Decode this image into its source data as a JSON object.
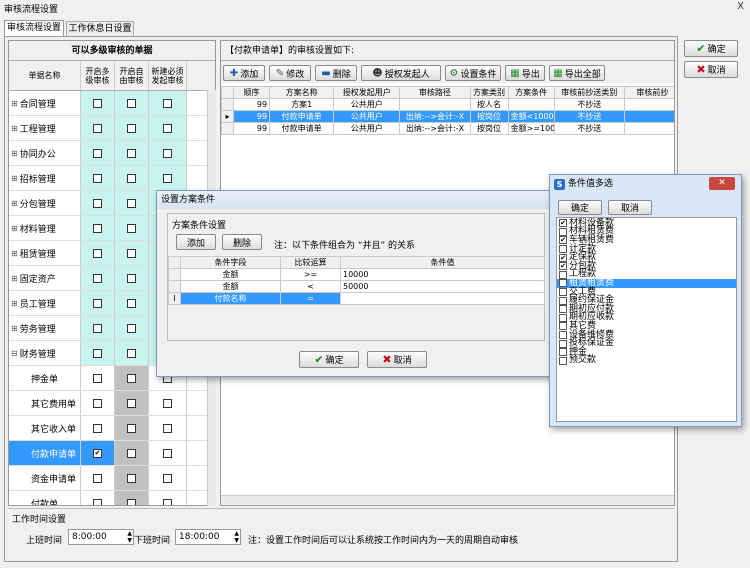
{
  "window": {
    "title": "审核流程设置",
    "close": "X"
  },
  "tabs": [
    "审核流程设置",
    "工作休息日设置"
  ],
  "left": {
    "header": "可以多级审核的单据",
    "cols": [
      "单据名称",
      "开启多级审核",
      "开启自由审核",
      "新建必须发起审核"
    ],
    "rows": [
      {
        "name": "合同管理",
        "tree": "⊞",
        "c": [
          0,
          0,
          0
        ]
      },
      {
        "name": "工程管理",
        "tree": "⊞",
        "c": [
          0,
          0,
          0
        ]
      },
      {
        "name": "协同办公",
        "tree": "⊞",
        "c": [
          0,
          0,
          0
        ]
      },
      {
        "name": "招标管理",
        "tree": "⊞",
        "c": [
          0,
          0,
          0
        ]
      },
      {
        "name": "分包管理",
        "tree": "⊞",
        "c": [
          0,
          0,
          0
        ]
      },
      {
        "name": "材料管理",
        "tree": "⊞",
        "c": [
          0,
          0,
          0
        ]
      },
      {
        "name": "租赁管理",
        "tree": "⊞",
        "c": [
          0,
          0,
          0
        ]
      },
      {
        "name": "固定资产",
        "tree": "⊞",
        "c": [
          0,
          0,
          0
        ]
      },
      {
        "name": "员工管理",
        "tree": "⊞",
        "c": [
          0,
          0,
          0
        ]
      },
      {
        "name": "劳务管理",
        "tree": "⊞",
        "c": [
          0,
          0,
          0
        ]
      },
      {
        "name": "财务管理",
        "tree": "⊟",
        "c": [
          0,
          0,
          0
        ]
      },
      {
        "name": "押金单",
        "tree": "",
        "c": [
          0,
          0,
          0
        ]
      },
      {
        "name": "其它费用单",
        "tree": "",
        "c": [
          0,
          0,
          0
        ]
      },
      {
        "name": "其它收入单",
        "tree": "",
        "c": [
          0,
          0,
          0
        ]
      },
      {
        "name": "付款申请单",
        "tree": "",
        "c": [
          1,
          0,
          0
        ]
      },
      {
        "name": "资金申请单",
        "tree": "",
        "c": [
          0,
          0,
          0
        ]
      },
      {
        "name": "付款单",
        "tree": "",
        "c": [
          0,
          0,
          0
        ]
      }
    ]
  },
  "right": {
    "header": "【付款申请单】的审核设置如下:",
    "toolbar": [
      "添加",
      "修改",
      "删除",
      "授权发起人",
      "设置条件",
      "导出",
      "导出全部"
    ],
    "cols": [
      "顺序",
      "方案名称",
      "授权发起用户",
      "审核路径",
      "方案类别",
      "方案条件",
      "审核前抄送类别",
      "审核前抄"
    ],
    "rows": [
      [
        "99",
        "方案1",
        "公共用户",
        "",
        "按人名",
        "",
        "不抄送",
        ""
      ],
      [
        "99",
        "付款申请单",
        "公共用户",
        "出纳:-->会计:-X",
        "按岗位",
        "金额<1000",
        "不抄送",
        ""
      ],
      [
        "99",
        "付款申请单",
        "公共用户",
        "出纳:-->会计:-X",
        "按岗位",
        "金额>=100",
        "不抄送",
        ""
      ]
    ]
  },
  "actions": {
    "ok": "确定",
    "cancel": "取消"
  },
  "worktime": {
    "title": "工作时间设置",
    "on_label": "上班时间",
    "on_value": "8:00:00",
    "off_label": "下班时间",
    "off_value": "18:00:00",
    "note": "注：设置工作时间后可以让系统按工作时间内为一天的周期自动审核"
  },
  "dialog": {
    "title": "设置方案条件",
    "group": "方案条件设置",
    "add": "添加",
    "del": "删除",
    "note": "注：以下条件组合为 “并且” 的关系",
    "cols": [
      "条件字段",
      "比较运算",
      "条件值"
    ],
    "rows": [
      [
        "金额",
        ">=",
        "10000"
      ],
      [
        "金额",
        "<",
        "50000"
      ],
      [
        "付款名称",
        "=",
        ""
      ]
    ],
    "ok": "确定",
    "cancel": "取消"
  },
  "multi": {
    "title": "条件值多选",
    "ok": "确定",
    "cancel": "取消",
    "items": [
      {
        "t": "材料设备款",
        "c": 1
      },
      {
        "t": "材料租赁费",
        "c": 0
      },
      {
        "t": "车辆租赁费",
        "c": 1
      },
      {
        "t": "计定款",
        "c": 0
      },
      {
        "t": "定保款",
        "c": 1
      },
      {
        "t": "分包款",
        "c": 1
      },
      {
        "t": "工程款",
        "c": 0
      },
      {
        "t": "租赁租赁费",
        "c": 1
      },
      {
        "t": "交工费",
        "c": 0
      },
      {
        "t": "履约保证金",
        "c": 0
      },
      {
        "t": "期初应付款",
        "c": 0
      },
      {
        "t": "期初应收款",
        "c": 0
      },
      {
        "t": "其它费",
        "c": 0
      },
      {
        "t": "设备维修费",
        "c": 0
      },
      {
        "t": "投标保证金",
        "c": 0
      },
      {
        "t": "押金",
        "c": 0
      },
      {
        "t": "预交款",
        "c": 0
      }
    ]
  },
  "colors": {
    "teal": "#c9f3ef",
    "select": "#3399ff",
    "gray": "#c0c0c0"
  }
}
